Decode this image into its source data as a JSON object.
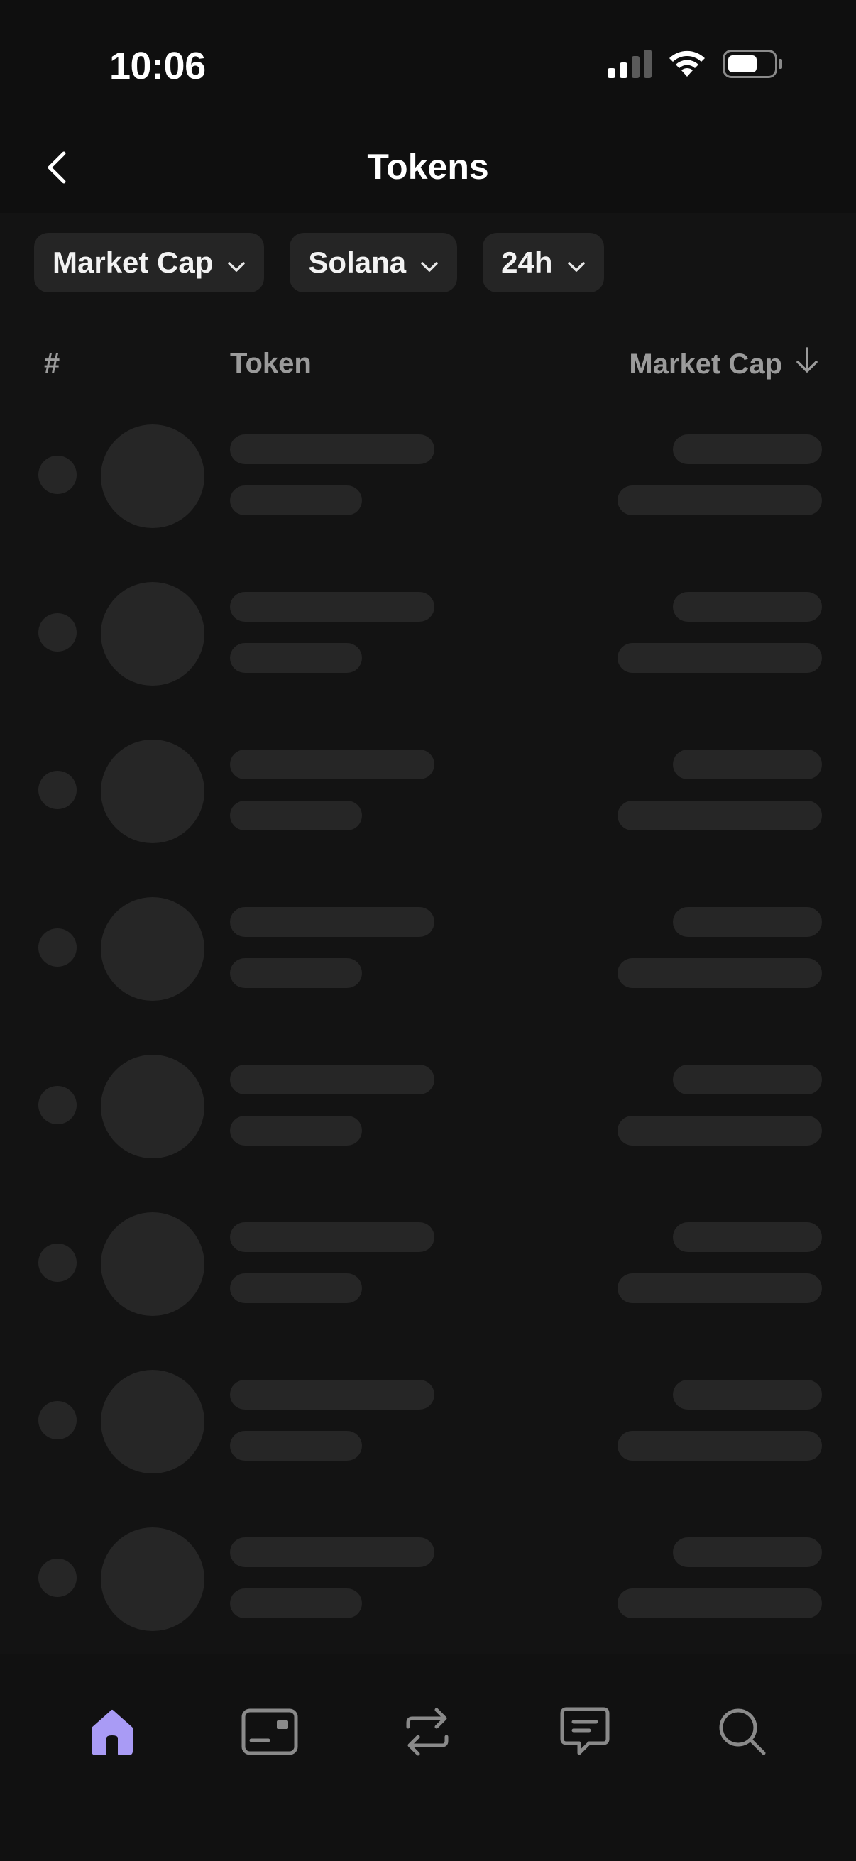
{
  "status_bar": {
    "time": "10:06",
    "icons": [
      "cellular-signal-icon",
      "wifi-icon",
      "battery-icon"
    ]
  },
  "header": {
    "title": "Tokens",
    "back_icon": "chevron-left-icon"
  },
  "filters": [
    {
      "label": "Market Cap"
    },
    {
      "label": "Solana"
    },
    {
      "label": "24h"
    }
  ],
  "table": {
    "columns": {
      "rank": "#",
      "token": "Token",
      "market_cap": "Market Cap"
    },
    "sort_icon": "arrow-down-icon",
    "loading_rows": 8
  },
  "tab_bar": {
    "tabs": [
      {
        "name": "home",
        "icon": "home-icon",
        "active": true
      },
      {
        "name": "cards",
        "icon": "card-icon",
        "active": false
      },
      {
        "name": "swap",
        "icon": "swap-arrows-icon",
        "active": false
      },
      {
        "name": "messages",
        "icon": "chat-icon",
        "active": false
      },
      {
        "name": "search",
        "icon": "search-icon",
        "active": false
      }
    ]
  },
  "colors": {
    "background": "#131313",
    "skeleton": "#262626",
    "chip": "#252525",
    "accent": "#a99bf5",
    "icon_inactive": "#8a8a8a",
    "muted_text": "#9b9b9b"
  }
}
